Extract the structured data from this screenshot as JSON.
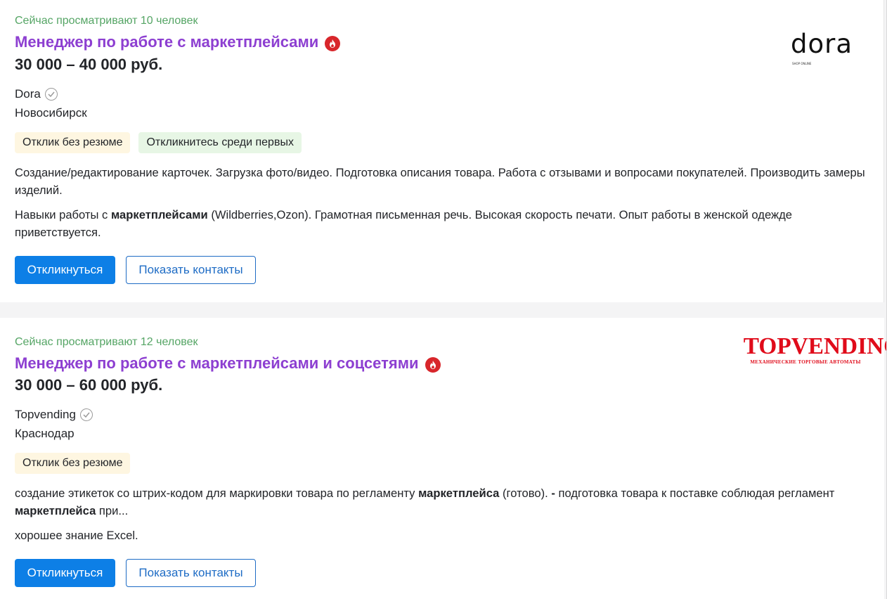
{
  "vacancies": [
    {
      "viewers": "Сейчас просматривают 10 человек",
      "title": "Менеджер по работе с маркетплейсами",
      "salary": "30 000 – 40 000 руб.",
      "company": "Dora",
      "city": "Новосибирск",
      "tags": [
        "Отклик без резюме",
        "Откликнитесь среди первых"
      ],
      "desc1": "Создание/редактирование карточек. Загрузка фото/видео. Подготовка описания товара. Работа с отзывами и вопросами покупателей. Производить замеры изделий.",
      "desc2_before": "Навыки работы с ",
      "desc2_bold": "маркетплейсами",
      "desc2_after": " (Wildberries,Ozon). Грамотная письменная речь. Высокая скорость печати. Опыт работы в женской одежде приветствуется.",
      "respond_label": "Откликнуться",
      "contacts_label": "Показать контакты",
      "logo_text": "dora",
      "logo_subtext": "SHOP ONLINE"
    },
    {
      "viewers": "Сейчас просматривают 12 человек",
      "title": "Менеджер по работе с маркетплейсами и соцсетями",
      "salary": "30 000 – 60 000 руб.",
      "company": "Topvending",
      "city": "Краснодар",
      "tags": [
        "Отклик без резюме"
      ],
      "desc1_a": "создание этикеток со штрих-кодом для маркировки товара по регламенту ",
      "desc1_b": "маркетплейса",
      "desc1_c": " (готово). ",
      "desc1_d": "-",
      "desc1_e": " подготовка товара к поставке соблюдая регламент ",
      "desc1_f": "маркетплейса",
      "desc1_g": " при...",
      "desc2": "хорошее знание Excel.",
      "respond_label": "Откликнуться",
      "contacts_label": "Показать контакты",
      "logo_text": "TOPVENDING",
      "logo_subtext": "МЕХАНИЧЕСКИЕ ТОРГОВЫЕ АВТОМАТЫ"
    }
  ],
  "colors": {
    "viewers": "#55a565",
    "title": "#8d3fd1",
    "hot_badge": "#d8262b",
    "primary": "#0d7fe6",
    "tag_yellow": "#fef6e1",
    "tag_green": "#e7f6e5"
  },
  "icons": {
    "hot": "fire-icon",
    "verified": "check-circle-icon"
  }
}
